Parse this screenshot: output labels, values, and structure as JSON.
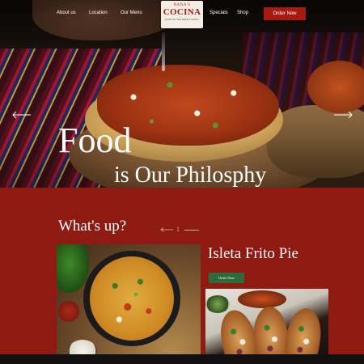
{
  "nav": {
    "left_links": [
      "About us",
      "Location",
      "Our Menu"
    ],
    "right_links": [
      "Specials",
      "Shop"
    ],
    "order_label": "Order Now"
  },
  "logo": {
    "top": "NANA'S",
    "main": "COCINA",
    "sub": "FOOD OF THE BRAVO FAMILY"
  },
  "hero": {
    "title_line1": "Food",
    "title_line2": "is Our Philosphy",
    "prev_icon": "arrow-left-icon",
    "next_icon": "arrow-right-icon"
  },
  "section": {
    "heading": "What's up?",
    "pager_number": "1"
  },
  "featured": {
    "title": "Isleta Frito Pie",
    "order_label": "Order Now"
  },
  "colors": {
    "background": "#8e1a12",
    "order_button": "#a8190f",
    "small_order_button": "#2e6b3c",
    "logo_text": "#9a1b12"
  }
}
